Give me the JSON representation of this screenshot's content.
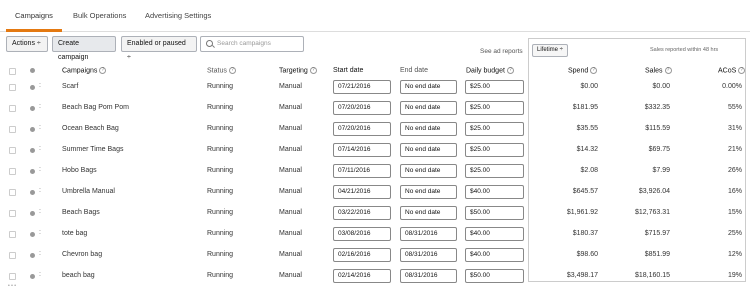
{
  "tabs": [
    "Campaigns",
    "Bulk Operations",
    "Advertising Settings"
  ],
  "toolbar": {
    "actions": "Actions ÷",
    "create": "Create campaign",
    "filter": "Enabled or paused ÷",
    "search_placeholder": "Search campaigns"
  },
  "see_reports": "See ad reports",
  "lifetime": "Lifetime ÷",
  "sales_note": "Sales reported within 48 hrs",
  "headers": {
    "campaigns": "Campaigns",
    "status": "Status",
    "targeting": "Targeting",
    "start": "Start date",
    "end": "End date",
    "budget": "Daily budget",
    "spend": "Spend",
    "sales": "Sales",
    "acos": "ACoS"
  },
  "colors": {
    "accent": "#e47911"
  },
  "rows": [
    {
      "name": "Scarf",
      "status": "Running",
      "targeting": "Manual",
      "start": "07/21/2016",
      "end": "No end date",
      "budget": "$25.00",
      "spend": "$0.00",
      "sales": "$0.00",
      "acos": "0.00%"
    },
    {
      "name": "Beach Bag Pom Pom",
      "status": "Running",
      "targeting": "Manual",
      "start": "07/20/2016",
      "end": "No end date",
      "budget": "$25.00",
      "spend": "$181.95",
      "sales": "$332.35",
      "acos": "55%"
    },
    {
      "name": "Ocean Beach Bag",
      "status": "Running",
      "targeting": "Manual",
      "start": "07/20/2016",
      "end": "No end date",
      "budget": "$25.00",
      "spend": "$35.55",
      "sales": "$115.59",
      "acos": "31%"
    },
    {
      "name": "Summer Time Bags",
      "status": "Running",
      "targeting": "Manual",
      "start": "07/14/2016",
      "end": "No end date",
      "budget": "$25.00",
      "spend": "$14.32",
      "sales": "$69.75",
      "acos": "21%"
    },
    {
      "name": "Hobo Bags",
      "status": "Running",
      "targeting": "Manual",
      "start": "07/11/2016",
      "end": "No end date",
      "budget": "$25.00",
      "spend": "$2.08",
      "sales": "$7.99",
      "acos": "26%"
    },
    {
      "name": "Umbrella Manual",
      "status": "Running",
      "targeting": "Manual",
      "start": "04/21/2016",
      "end": "No end date",
      "budget": "$40.00",
      "spend": "$645.57",
      "sales": "$3,926.04",
      "acos": "16%"
    },
    {
      "name": "Beach Bags",
      "status": "Running",
      "targeting": "Manual",
      "start": "03/22/2016",
      "end": "No end date",
      "budget": "$50.00",
      "spend": "$1,961.92",
      "sales": "$12,763.31",
      "acos": "15%"
    },
    {
      "name": "tote bag",
      "status": "Running",
      "targeting": "Manual",
      "start": "03/08/2016",
      "end": "08/31/2016",
      "budget": "$40.00",
      "spend": "$180.37",
      "sales": "$715.97",
      "acos": "25%"
    },
    {
      "name": "Chevron bag",
      "status": "Running",
      "targeting": "Manual",
      "start": "02/16/2016",
      "end": "08/31/2016",
      "budget": "$40.00",
      "spend": "$98.60",
      "sales": "$851.99",
      "acos": "12%"
    },
    {
      "name": "beach bag",
      "status": "Running",
      "targeting": "Manual",
      "start": "02/14/2016",
      "end": "08/31/2016",
      "budget": "$50.00",
      "spend": "$3,498.17",
      "sales": "$18,160.15",
      "acos": "19%"
    }
  ]
}
